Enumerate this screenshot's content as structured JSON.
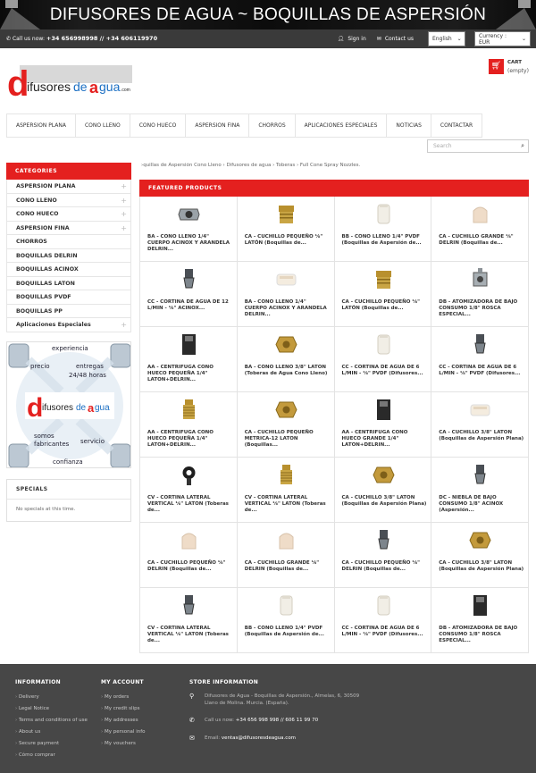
{
  "banner": {
    "title": "DIFUSORES DE AGUA ~ BOQUILLAS DE ASPERSIÓN"
  },
  "topbar": {
    "call_label": "Call us now:",
    "phones": "+34 656998998 // +34 606119970",
    "signin": "Sign in",
    "contact": "Contact us",
    "language": "English",
    "currency": "Currency : EUR"
  },
  "logo": {
    "text": "difusoresdeagua.com"
  },
  "cart": {
    "label": "CART",
    "status": "(empty)"
  },
  "nav": [
    "ASPERSION PLANA",
    "CONO LLENO",
    "CONO HUECO",
    "ASPERSION FINA",
    "CHORROS",
    "APLICACIONES ESPECIALES",
    "NOTICIAS",
    "CONTACTAR"
  ],
  "search": {
    "placeholder": "Search"
  },
  "sidebar": {
    "title": "CATEGORIES",
    "categories": [
      {
        "label": "ASPERSION PLANA",
        "expandable": true
      },
      {
        "label": "CONO LLENO",
        "expandable": true
      },
      {
        "label": "CONO HUECO",
        "expandable": true
      },
      {
        "label": "ASPERSION FINA",
        "expandable": true
      },
      {
        "label": "CHORROS",
        "expandable": false
      },
      {
        "label": "BOQUILLAS DELRIN",
        "expandable": false
      },
      {
        "label": "BOQUILLAS ACINOX",
        "expandable": false
      },
      {
        "label": "BOQUILLAS LATON",
        "expandable": false
      },
      {
        "label": "BOQUILLAS PVDF",
        "expandable": false
      },
      {
        "label": "BOQUILLAS PP",
        "expandable": false
      },
      {
        "label": "Aplicaciones Especiales",
        "expandable": true
      }
    ],
    "promo": {
      "words": [
        "experiencia",
        "precio",
        "entregas",
        "24/48 horas",
        "somos",
        "fabricantes",
        "servicio",
        "confianza"
      ],
      "logo_text": "difusoresdeagua.com"
    },
    "specials": {
      "title": "SPECIALS",
      "text": "No specials at this time."
    }
  },
  "breadcrumb": "›quillas de Aspersión Cono Lleno  ›  Difusores de agua  ›  Toberas  ›  Full Cone Spray Nozzles.",
  "featured": {
    "title": "FEATURED PRODUCTS",
    "products": [
      {
        "name": "BA - CONO LLENO 1/4\" CUERPO ACINOX Y ARANDELA DELRIN...",
        "img": "steel-nozzle"
      },
      {
        "name": "CA - CUCHILLO PEQUEÑO ⅛\" LATÓN (Boquillas de...",
        "img": "brass-cap"
      },
      {
        "name": "BB - CONO LLENO 1/4\" PVDF (Boquillas de Aspersión de...",
        "img": "white-nozzle"
      },
      {
        "name": "CA - CUCHILLO GRANDE ⅛\" DELRIN (Boquillas de...",
        "img": "delrin-cap"
      },
      {
        "name": "CC - CORTINA DE AGUA DE 12 L/MIN - ⅛\" ACINOX...",
        "img": "steel-fan"
      },
      {
        "name": "BA - CONO LLENO 1/4\" CUERPO ACINOX Y ARANDELA DELRIN...",
        "img": "white-pad"
      },
      {
        "name": "CA - CUCHILLO PEQUEÑO ⅛\" LATÓN (Boquillas de...",
        "img": "brass-cap"
      },
      {
        "name": "DB - ATOMIZADORA DE BAJO CONSUMO 1/8\" ROSCA ESPECIAL...",
        "img": "steel-block"
      },
      {
        "name": "AA - CENTRIFUGA CONO HUECO PEQUEÑA 1/4\" LATON+DELRIN...",
        "img": "black-box"
      },
      {
        "name": "BA - CONO LLENO 3/8\" LATON (Toberas de Agua Cono Lleno)",
        "img": "brass-hex"
      },
      {
        "name": "CC - CORTINA DE AGUA DE 6 L/MIN - ⅛\" PVDF (Difusores...",
        "img": "white-nozzle"
      },
      {
        "name": "CC - CORTINA DE AGUA DE 6 L/MIN - ⅛\" PVDF (Difusores...",
        "img": "steel-fan"
      },
      {
        "name": "AA - CENTRIFUGA CONO HUECO PEQUEÑA 1/4\" LATON+DELRIN...",
        "img": "brass-thread"
      },
      {
        "name": "CA - CUCHILLO PEQUEÑO METRICA-12 LATON (Boquillas...",
        "img": "brass-hex"
      },
      {
        "name": "AA - CENTRIFUGA CONO HUECO GRANDE 1/4\" LATON+DELRIN...",
        "img": "black-box"
      },
      {
        "name": "CA - CUCHILLO 3/8\" LATON (Boquillas de Aspersión Plana)",
        "img": "white-pad"
      },
      {
        "name": "CV - CORTINA LATERAL VERTICAL ⅛\" LATON (Toberas de...",
        "img": "black-swivel"
      },
      {
        "name": "CV - CORTINA LATERAL VERTICAL ⅛\" LATON (Toberas de...",
        "img": "brass-thread"
      },
      {
        "name": "CA - CUCHILLO 3/8\" LATON (Boquillas de Aspersión Plana)",
        "img": "brass-hex"
      },
      {
        "name": "DC - NIEBLA DE BAJO CONSUMO 1/8\" ACINOX (Aspersión...",
        "img": "steel-fan"
      },
      {
        "name": "CA - CUCHILLO PEQUEÑO ⅛\" DELRIN (Boquillas de...",
        "img": "delrin-cap"
      },
      {
        "name": "CA - CUCHILLO GRANDE ⅛\" DELRIN (Boquillas de...",
        "img": "delrin-cap"
      },
      {
        "name": "CA - CUCHILLO PEQUEÑO ⅛\" DELRIN (Boquillas de...",
        "img": "steel-fan"
      },
      {
        "name": "CA - CUCHILLO 3/8\" LATON (Boquillas de Aspersión Plana)",
        "img": "brass-hex"
      },
      {
        "name": "CV - CORTINA LATERAL VERTICAL ⅛\" LATON (Toberas de...",
        "img": "steel-fan"
      },
      {
        "name": "BB - CONO LLENO 1/4\" PVDF (Boquillas de Aspersión de...",
        "img": "white-nozzle"
      },
      {
        "name": "CC - CORTINA DE AGUA DE 6 L/MIN - ⅛\" PVDF (Difusores...",
        "img": "white-nozzle"
      },
      {
        "name": "DB - ATOMIZADORA DE BAJO CONSUMO 1/8\" ROSCA ESPECIAL...",
        "img": "black-box"
      }
    ]
  },
  "footer": {
    "information": {
      "title": "INFORMATION",
      "links": [
        "Delivery",
        "Legal Notice",
        "Terms and conditions of use",
        "About us",
        "Secure payment",
        "Cómo comprar"
      ]
    },
    "account": {
      "title": "MY ACCOUNT",
      "links": [
        "My orders",
        "My credit slips",
        "My addresses",
        "My personal info",
        "My vouchers"
      ]
    },
    "store": {
      "title": "STORE INFORMATION",
      "address": "Difusores de Agua - Boquillas de Aspersión., Almeías, 6, 30509 Llano de Molina. Murcia. (España).",
      "call_label": "Call us now:",
      "phones": "+34 656 998 998 // 606 11 99 70",
      "email_label": "Email:",
      "email": "ventas@difusoresdeagua.com"
    }
  },
  "colors": {
    "accent": "#e4201f",
    "topbar": "#3a3a3a",
    "footer": "#474747"
  }
}
